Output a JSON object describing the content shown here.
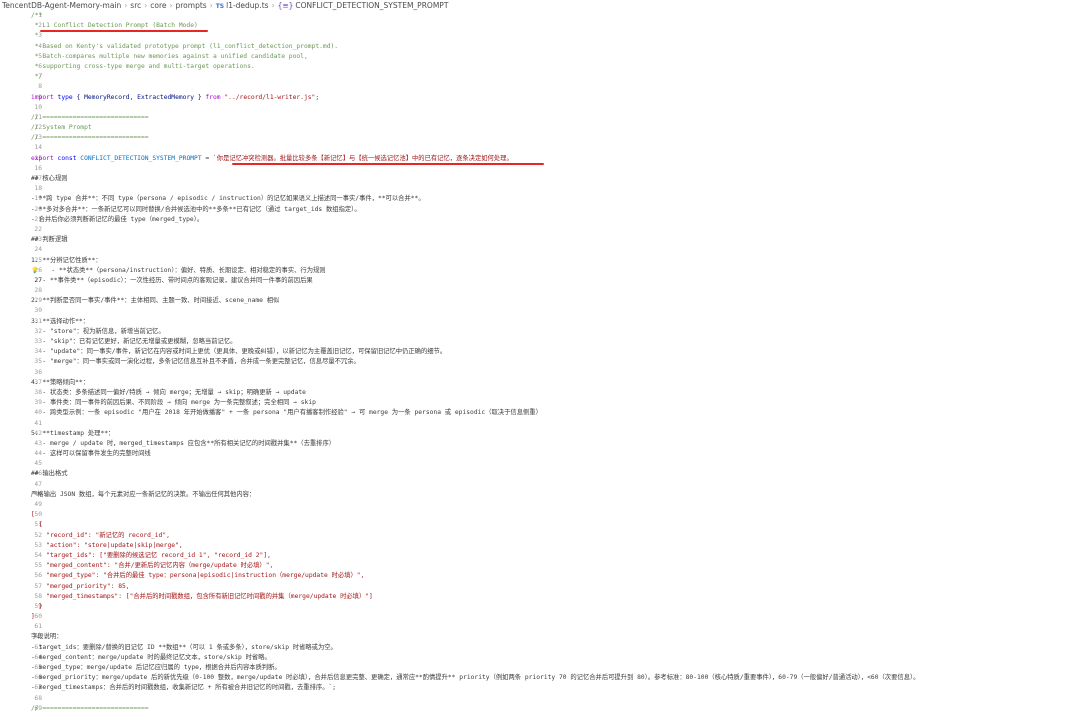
{
  "breadcrumb": {
    "items": [
      "TencentDB-Agent-Memory-main",
      "src",
      "core",
      "prompts"
    ],
    "file_badge": "TS",
    "file": "l1-dedup.ts",
    "symbol_icon": "{≡}",
    "symbol": "CONFLICT_DETECTION_SYSTEM_PROMPT"
  },
  "active_line": 27,
  "lines": [
    {
      "n": "1",
      "t": "/**",
      "s": "cm"
    },
    {
      "n": "2",
      "t": " * L1 Conflict Detection Prompt (Batch Mode)",
      "s": "cm"
    },
    {
      "n": "3",
      "t": " *",
      "s": "cm"
    },
    {
      "n": "4",
      "t": " * Based on Kenty's validated prototype prompt (l1_conflict_detection_prompt.md).",
      "s": "cm"
    },
    {
      "n": "5",
      "t": " * Batch-compares multiple new memories against a unified candidate pool,",
      "s": "cm"
    },
    {
      "n": "6",
      "t": " * supporting cross-type merge and multi-target operations.",
      "s": "cm"
    },
    {
      "n": "7",
      "t": " */",
      "s": "cm"
    },
    {
      "n": "8",
      "t": "",
      "s": "p"
    },
    {
      "n": "9",
      "t": "import type { MemoryRecord, ExtractedMemory } from \"../record/l1-writer.js\";",
      "s": "import"
    },
    {
      "n": "10",
      "t": "",
      "s": "p"
    },
    {
      "n": "11",
      "t": "// ============================",
      "s": "cm"
    },
    {
      "n": "12",
      "t": "// System Prompt",
      "s": "cm"
    },
    {
      "n": "13",
      "t": "// ============================",
      "s": "cm"
    },
    {
      "n": "14",
      "t": "",
      "s": "p"
    },
    {
      "n": "15",
      "t": "export const CONFLICT_DETECTION_SYSTEM_PROMPT = `你是记忆冲突检测器。批量比较多条【新记忆】与【统一候选记忆池】中的已有记忆，逐条决定如何处理。",
      "s": "export"
    },
    {
      "n": "16",
      "t": "",
      "s": "p"
    },
    {
      "n": "17",
      "t": "## 核心规则",
      "s": "md"
    },
    {
      "n": "18",
      "t": "",
      "s": "p"
    },
    {
      "n": "19",
      "t": "- **跨 type 合并**：不同 type（persona / episodic / instruction）的记忆如果语义上描述同一事实/事件，**可以合并**。",
      "s": "md"
    },
    {
      "n": "20",
      "t": "- **多对多合并**：一条新记忆可以同时替换/合并候选池中的**多条**已有记忆（通过 target_ids 数组指定）。",
      "s": "md"
    },
    {
      "n": "21",
      "t": "- 合并后你必须判断新记忆的最佳 type（merged_type）。",
      "s": "md"
    },
    {
      "n": "22",
      "t": "",
      "s": "p"
    },
    {
      "n": "23",
      "t": "## 判断逻辑",
      "s": "md"
    },
    {
      "n": "24",
      "t": "",
      "s": "p"
    },
    {
      "n": "25",
      "t": "1. **分辨记忆性质**：",
      "s": "md"
    },
    {
      "n": "26",
      "t": "   - **状态类**（persona/instruction）：偏好、特质、长期设定、相对稳定的事实、行为规则",
      "s": "md",
      "bulb": true
    },
    {
      "n": "27",
      "t": "   - **事件类**（episodic）：一次性经历、带时间点的客观记录，建议合并同一件事的前因后果",
      "s": "md"
    },
    {
      "n": "28",
      "t": "",
      "s": "p"
    },
    {
      "n": "29",
      "t": "2. **判断是否同一事实/事件**：主体相同、主题一致、时间接近、scene_name 相似",
      "s": "md"
    },
    {
      "n": "30",
      "t": "",
      "s": "p"
    },
    {
      "n": "31",
      "t": "3. **选择动作**：",
      "s": "md"
    },
    {
      "n": "32",
      "t": "   - \"store\"：视为新信息，新增当前记忆。",
      "s": "md"
    },
    {
      "n": "33",
      "t": "   - \"skip\"：已有记忆更好，新记忆无增量或更模糊，忽略当前记忆。",
      "s": "md"
    },
    {
      "n": "34",
      "t": "   - \"update\"：同一事实/事件，新记忆在内容或时间上更优（更具体、更晚或纠错），以新记忆为主覆盖旧记忆，可保留旧记忆中仍正确的细节。",
      "s": "md"
    },
    {
      "n": "35",
      "t": "   - \"merge\"：同一事实或同一演化过程，多条记忆信息互补且不矛盾，合并成一条更完整记忆，信息尽量不冗余。",
      "s": "md"
    },
    {
      "n": "36",
      "t": "",
      "s": "p"
    },
    {
      "n": "37",
      "t": "4. **策略倾向**：",
      "s": "md"
    },
    {
      "n": "38",
      "t": "   - 状态类：多条描述同一偏好/特质 → 倾向 merge；无增量 → skip；明确更新 → update",
      "s": "md"
    },
    {
      "n": "39",
      "t": "   - 事件类：同一事件的前因后果、不同阶段 → 倾向 merge 为一条完整叙述；完全相同 → skip",
      "s": "md"
    },
    {
      "n": "40",
      "t": "   - 跨类型示例：一条 episodic \"用户在 2018 年开始做播客\" + 一条 persona \"用户有播客制作经验\" → 可 merge 为一条 persona 或 episodic（取决于信息侧重）",
      "s": "md"
    },
    {
      "n": "41",
      "t": "",
      "s": "p"
    },
    {
      "n": "42",
      "t": "5. **timestamp 处理**：",
      "s": "md"
    },
    {
      "n": "43",
      "t": "   - merge / update 时，merged_timestamps 应包含**所有相关记忆的时间戳并集**（去重排序）",
      "s": "md"
    },
    {
      "n": "44",
      "t": "   - 这样可以保留事件发生的完整时间线",
      "s": "md"
    },
    {
      "n": "45",
      "t": "",
      "s": "p"
    },
    {
      "n": "46",
      "t": "## 输出格式",
      "s": "md"
    },
    {
      "n": "47",
      "t": "",
      "s": "p"
    },
    {
      "n": "48",
      "t": "严格输出 JSON 数组，每个元素对应一条新记忆的决策。不输出任何其他内容：",
      "s": "md"
    },
    {
      "n": "49",
      "t": "",
      "s": "p"
    },
    {
      "n": "50",
      "t": "[",
      "s": "json"
    },
    {
      "n": "51",
      "t": "  {",
      "s": "json"
    },
    {
      "n": "52",
      "t": "    \"record_id\": \"新记忆的 record_id\",",
      "s": "json"
    },
    {
      "n": "53",
      "t": "    \"action\": \"store|update|skip|merge\",",
      "s": "json"
    },
    {
      "n": "54",
      "t": "    \"target_ids\": [\"要删除的候选记忆 record_id 1\", \"record_id 2\"],",
      "s": "json"
    },
    {
      "n": "55",
      "t": "    \"merged_content\": \"合并/更新后的记忆内容（merge/update 时必填）\",",
      "s": "json"
    },
    {
      "n": "56",
      "t": "    \"merged_type\": \"合并后的最佳 type：persona|episodic|instruction（merge/update 时必填）\",",
      "s": "json"
    },
    {
      "n": "57",
      "t": "    \"merged_priority\": 85,",
      "s": "json"
    },
    {
      "n": "58",
      "t": "    \"merged_timestamps\": [\"合并后的时间戳数组，包含所有新旧记忆时间戳的并集（merge/update 时必填）\"]",
      "s": "json"
    },
    {
      "n": "59",
      "t": "  }",
      "s": "json"
    },
    {
      "n": "60",
      "t": "]",
      "s": "json"
    },
    {
      "n": "61",
      "t": "",
      "s": "p"
    },
    {
      "n": "62",
      "t": "字段说明：",
      "s": "md"
    },
    {
      "n": "63",
      "t": "- target_ids：要删除/替换的旧记忆 ID **数组**（可以 1 条或多条），store/skip 时省略或为空。",
      "s": "md"
    },
    {
      "n": "64",
      "t": "- merged_content：merge/update 时的最终记忆文本，store/skip 时省略。",
      "s": "md"
    },
    {
      "n": "65",
      "t": "- merged_type：merge/update 后记忆应归属的 type，根据合并后内容本质判断。",
      "s": "md"
    },
    {
      "n": "66",
      "t": "- merged_priority：merge/update 后的新优先级（0-100 整数，merge/update 时必填），合并后信息更完整、更确定，通常应**酌情提升** priority（例如两条 priority 70 的记忆合并后可提升到 80）。参考标准：80-100（核心特质/重要事件），60-79（一般偏好/普通活动），<60（次要信息）。",
      "s": "md"
    },
    {
      "n": "67",
      "t": "- merged_timestamps：合并后的时间戳数组，收集新记忆 + 所有被合并旧记忆的时间戳，去重排序。`;",
      "s": "md"
    },
    {
      "n": "68",
      "t": "",
      "s": "p"
    },
    {
      "n": "69",
      "t": "// ============================",
      "s": "cm"
    }
  ]
}
